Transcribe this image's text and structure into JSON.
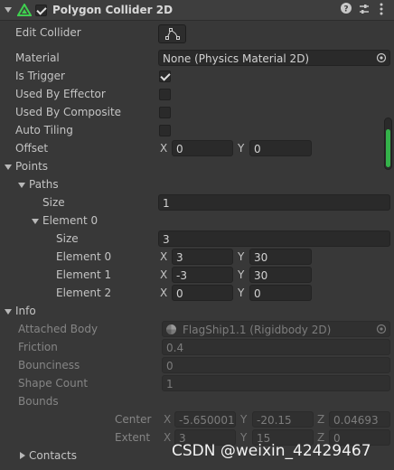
{
  "header": {
    "title": "Polygon Collider 2D",
    "enabled": true,
    "icons": [
      "collider-icon",
      "help-icon",
      "preset-icon",
      "more-icon"
    ]
  },
  "edit_collider": {
    "label": "Edit Collider"
  },
  "material": {
    "label": "Material",
    "value": "None (Physics Material 2D)"
  },
  "is_trigger": {
    "label": "Is Trigger",
    "checked": true
  },
  "used_by_effector": {
    "label": "Used By Effector",
    "checked": false
  },
  "used_by_composite": {
    "label": "Used By Composite",
    "checked": false
  },
  "auto_tiling": {
    "label": "Auto Tiling",
    "checked": false
  },
  "offset": {
    "label": "Offset",
    "x_axis": "X",
    "x": "0",
    "y_axis": "Y",
    "y": "0"
  },
  "points": {
    "label": "Points",
    "paths": {
      "label": "Paths",
      "size_label": "Size",
      "size": "1",
      "element0": {
        "label": "Element 0",
        "size_label": "Size",
        "size": "3",
        "rows": [
          {
            "label": "Element 0",
            "x_axis": "X",
            "x": "3",
            "y_axis": "Y",
            "y": "30"
          },
          {
            "label": "Element 1",
            "x_axis": "X",
            "x": "-3",
            "y_axis": "Y",
            "y": "30"
          },
          {
            "label": "Element 2",
            "x_axis": "X",
            "x": "0",
            "y_axis": "Y",
            "y": "0"
          }
        ]
      }
    }
  },
  "info": {
    "label": "Info",
    "attached_body": {
      "label": "Attached Body",
      "value": "FlagShip1.1 (Rigidbody 2D)"
    },
    "friction": {
      "label": "Friction",
      "value": "0.4"
    },
    "bounciness": {
      "label": "Bounciness",
      "value": "0"
    },
    "shape_count": {
      "label": "Shape Count",
      "value": "1"
    },
    "bounds": {
      "label": "Bounds",
      "center": {
        "label": "Center",
        "x_axis": "X",
        "x": "-5.650001",
        "y_axis": "Y",
        "y": "-20.15",
        "z_axis": "Z",
        "z": "0.04693"
      },
      "extent": {
        "label": "Extent",
        "x_axis": "X",
        "x": "3",
        "y_axis": "Y",
        "y": "15",
        "z_axis": "Z",
        "z": "0"
      }
    },
    "contacts": {
      "label": "Contacts"
    }
  },
  "watermark": "CSDN @weixin_42429467",
  "colors": {
    "accent_green": "#34b24a",
    "background": "#383838",
    "field": "#2a2a2a"
  }
}
